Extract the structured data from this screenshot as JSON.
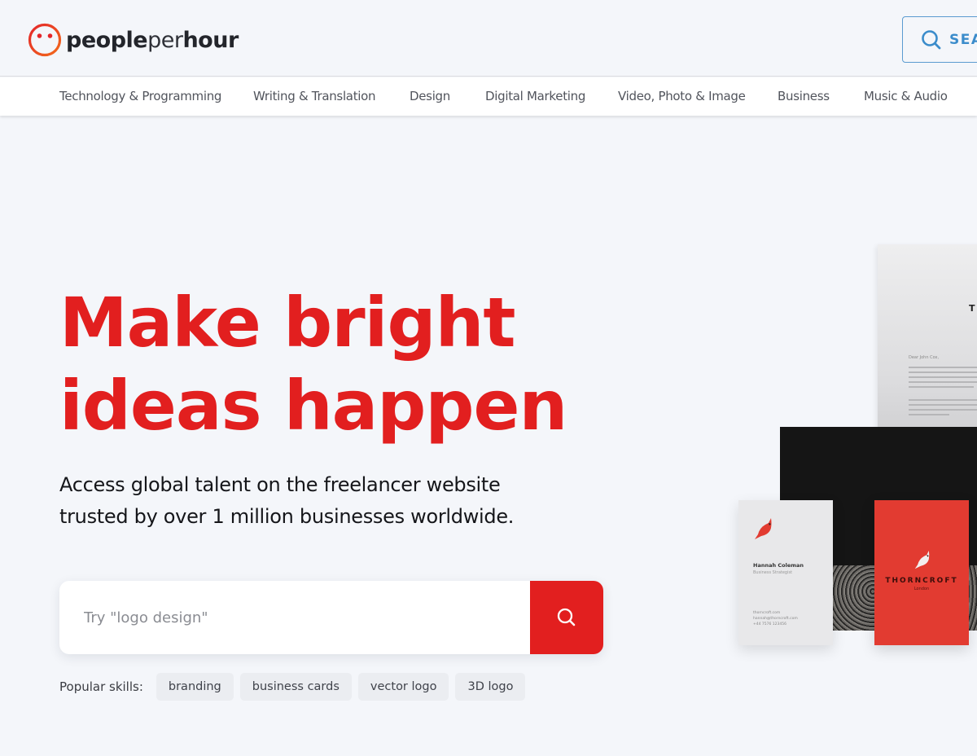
{
  "brand": {
    "name_part1": "people",
    "name_part2": "per",
    "name_part3": "hour",
    "accent_color": "#e21f1f",
    "logo_icon": "smiley-face-icon"
  },
  "header": {
    "search_button_label": "SEA",
    "search_icon": "search-icon"
  },
  "categories": [
    "Technology & Programming",
    "Writing & Translation",
    "Design",
    "Digital Marketing",
    "Video, Photo & Image",
    "Business",
    "Music & Audio"
  ],
  "hero": {
    "title_line1": "Make bright",
    "title_line2": "ideas happen",
    "subtitle_line1": "Access global talent on the freelancer website",
    "subtitle_line2": "trusted by over 1 million businesses worldwide.",
    "search_placeholder": "Try \"logo design\"",
    "search_button_icon": "search-icon",
    "popular_label": "Popular skills:",
    "popular_skills": [
      "branding",
      "business cards",
      "vector logo",
      "3D logo"
    ]
  },
  "illustration": {
    "description": "stationery mockup with letterhead and business cards",
    "letter_initial": "T",
    "letter_greeting": "Dear John Cox,",
    "card_name": "Hannah Coleman",
    "card_role": "Business Strategist",
    "card_contact_1": "thorncroft.com",
    "card_contact_2": "hannah@thorncroft.com",
    "card_contact_3": "+44 7576 123456",
    "red_card_brand": "THORNCROFT",
    "red_card_sub": "London"
  }
}
